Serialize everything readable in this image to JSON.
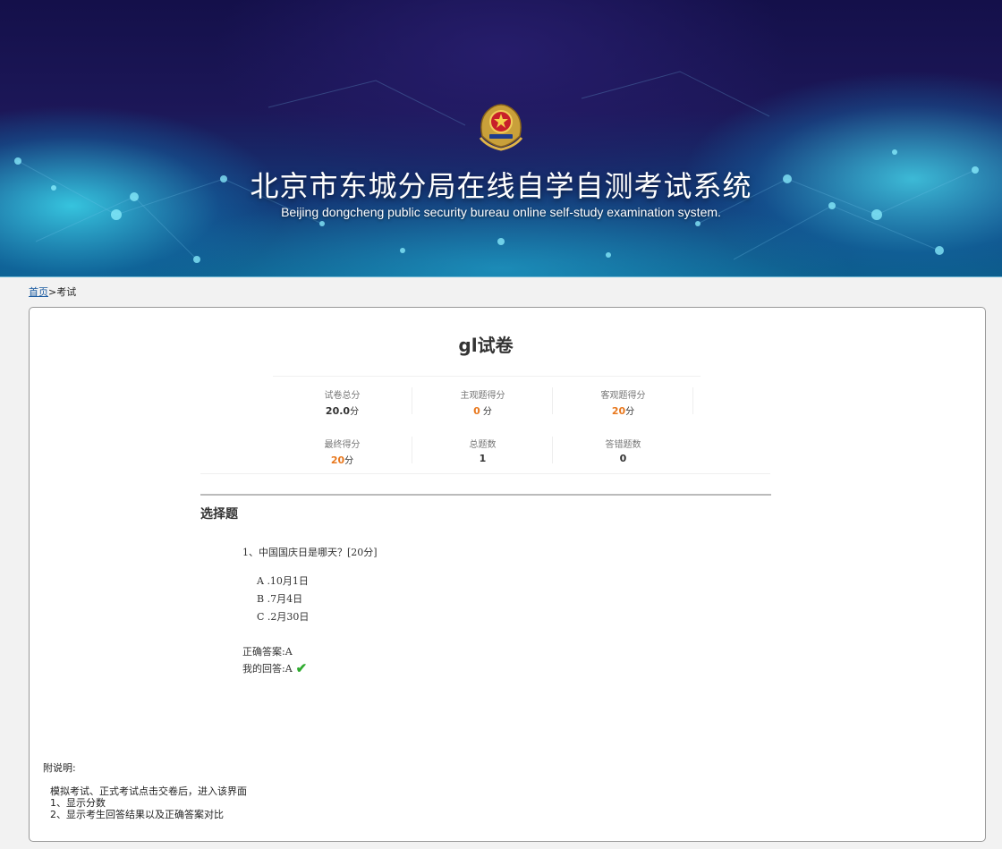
{
  "banner": {
    "title": "北京市东城分局在线自学自测考试系统",
    "subtitle": "Beijing dongcheng public security bureau online self-study examination system."
  },
  "breadcrumb": {
    "home": "首页",
    "separator": ">",
    "current": "考试"
  },
  "paper": {
    "title": "gl试卷",
    "stats": [
      {
        "label": "试卷总分",
        "value": "20.0",
        "unit": "分",
        "highlight": false
      },
      {
        "label": "主观题得分",
        "value": "0",
        "unit": " 分",
        "highlight": true
      },
      {
        "label": "客观题得分",
        "value": "20",
        "unit": "分",
        "highlight": true
      },
      {
        "label": "最终得分",
        "value": "20",
        "unit": "分",
        "highlight": true
      },
      {
        "label": "总题数",
        "value": "1",
        "unit": "",
        "highlight": false
      },
      {
        "label": "答错题数",
        "value": "0",
        "unit": "",
        "highlight": false
      }
    ]
  },
  "section": {
    "title": "选择题",
    "question": {
      "text": "1、中国国庆日是哪天？[20分]",
      "options": [
        "A .10月1日",
        "B .7月4日",
        "C .2月30日"
      ],
      "correct_answer": "正确答案:A",
      "my_answer": "我的回答:A",
      "check_mark": "✔"
    }
  },
  "notes": {
    "title": "附说明:",
    "lines": [
      "模拟考试、正式考试点击交卷后，进入该界面",
      "1、显示分数",
      "2、显示考生回答结果以及正确答案对比"
    ]
  },
  "colors": {
    "accent": "#e8781e",
    "check": "#2eab2e",
    "link": "#1a5aa0"
  }
}
